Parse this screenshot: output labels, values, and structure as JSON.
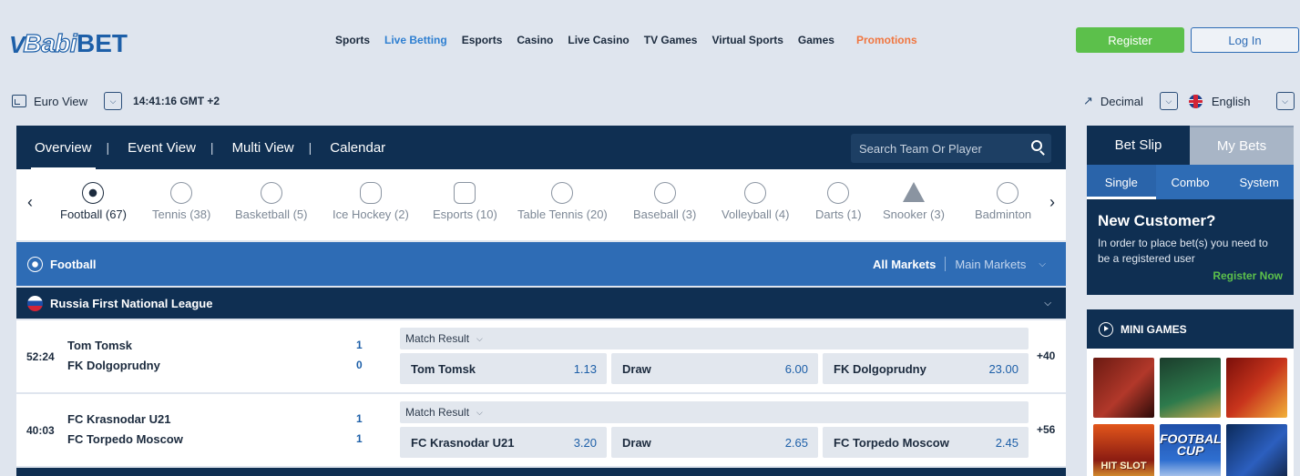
{
  "brand": {
    "logo_v": "V",
    "logo_babi": "Babi",
    "logo_bet": "BET"
  },
  "topnav": [
    "Sports",
    "Live Betting",
    "Esports",
    "Casino",
    "Live Casino",
    "TV Games",
    "Virtual Sports",
    "Games"
  ],
  "topnav_active": "Live Betting",
  "promotions": "Promotions",
  "auth": {
    "register": "Register",
    "login": "Log In"
  },
  "subbar": {
    "view": "Euro View",
    "time": "14:41:16 GMT +2",
    "odds_format": "Decimal",
    "language": "English"
  },
  "main_tabs": [
    "Overview",
    "Event View",
    "Multi View",
    "Calendar"
  ],
  "search": {
    "placeholder": "Search Team Or Player"
  },
  "sports": [
    {
      "label": "Football (67)",
      "icon": "football-icon"
    },
    {
      "label": "Tennis (38)",
      "icon": "tennis-icon"
    },
    {
      "label": "Basketball (5)",
      "icon": "basketball-icon"
    },
    {
      "label": "Ice Hockey (2)",
      "icon": "ice-hockey-icon"
    },
    {
      "label": "Esports (10)",
      "icon": "gamepad-icon"
    },
    {
      "label": "Table Tennis (20)",
      "icon": "table-tennis-icon"
    },
    {
      "label": "Baseball (3)",
      "icon": "baseball-icon"
    },
    {
      "label": "Volleyball (4)",
      "icon": "volleyball-icon"
    },
    {
      "label": "Darts (1)",
      "icon": "darts-icon"
    },
    {
      "label": "Snooker (3)",
      "icon": "snooker-icon"
    },
    {
      "label": "Badminton (",
      "icon": "badminton-icon"
    }
  ],
  "section": {
    "title": "Football",
    "all_markets": "All Markets",
    "main_markets": "Main Markets"
  },
  "league": {
    "name": "Russia First National League"
  },
  "matches": [
    {
      "time": "52:24",
      "team1": "Tom Tomsk",
      "score1": "1",
      "team2": "FK Dolgoprudny",
      "score2": "0",
      "market": "Match Result",
      "odds": [
        {
          "label": "Tom Tomsk",
          "value": "1.13"
        },
        {
          "label": "Draw",
          "value": "6.00"
        },
        {
          "label": "FK Dolgoprudny",
          "value": "23.00"
        }
      ],
      "more": "+40"
    },
    {
      "time": "40:03",
      "team1": "FC Krasnodar U21",
      "score1": "1",
      "team2": "FC Torpedo Moscow",
      "score2": "1",
      "market": "Match Result",
      "odds": [
        {
          "label": "FC Krasnodar U21",
          "value": "3.20"
        },
        {
          "label": "Draw",
          "value": "2.65"
        },
        {
          "label": "FC Torpedo Moscow",
          "value": "2.45"
        }
      ],
      "more": "+56"
    }
  ],
  "betslip": {
    "tab_slip": "Bet Slip",
    "tab_mybets": "My Bets",
    "sub": [
      "Single",
      "Combo",
      "System"
    ],
    "new_customer_title": "New Customer?",
    "new_customer_text": "In order to place bet(s) you need to be a registered user",
    "register_now": "Register Now"
  },
  "mini_games": {
    "title": "MINI GAMES",
    "thumb_texts": {
      "g5_line1": "FOOTBALL",
      "g5_line2": "CUP",
      "g4": "HIT SLOT"
    }
  },
  "colors": {
    "navy": "#0f2f52",
    "blue": "#2e6cb5",
    "green": "#5cc04b",
    "promo": "#f07640",
    "link_blue": "#2e7fd1"
  }
}
